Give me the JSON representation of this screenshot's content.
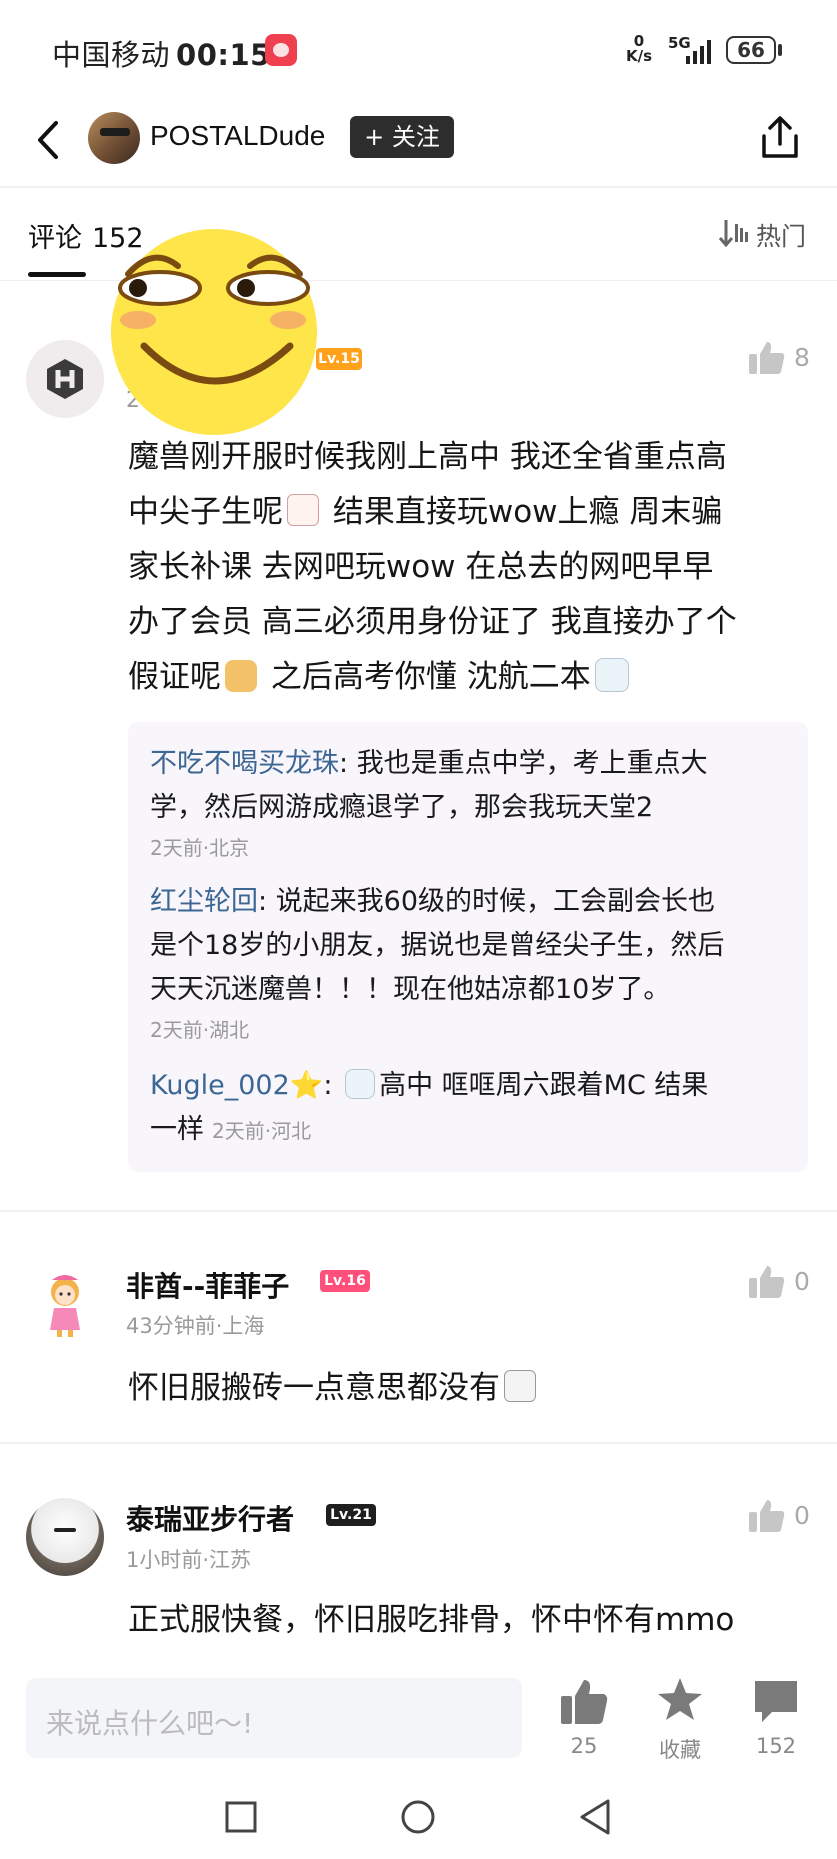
{
  "status_bar": {
    "carrier": "中国移动",
    "time": "00:15",
    "net_speed_value": "0",
    "net_speed_unit": "K/s",
    "network": "5G",
    "battery": "66"
  },
  "header": {
    "author": "POSTALDude",
    "follow_label": "+ 关注"
  },
  "comments_tab": {
    "label": "评论",
    "count": "152",
    "sort_label": "热门"
  },
  "comments": [
    {
      "level": "Lv.15",
      "time_fragment": "2",
      "likes": "8",
      "lines": [
        "魔兽刚开服时候我刚上高中 我还全省重点高",
        "中尖子生呢",
        "  结果直接玩wow上瘾 周末骗",
        "家长补课 去网吧玩wow  在总去的网吧早早",
        "办了会员 高三必须用身份证了 我直接办了个",
        "假证呢",
        " 之后高考你懂 沈航二本"
      ],
      "replies": [
        {
          "name": "不吃不喝买龙珠",
          "line1": "我也是重点中学，考上重点大",
          "line2": "学，然后网游成瘾退学了，那会我玩天堂2",
          "meta": "2天前·北京"
        },
        {
          "name": "红尘轮回",
          "line1": "说起来我60级的时候，工会副会长也",
          "line2": "是个18岁的小朋友，据说也是曾经尖子生，然后",
          "line3": "天天沉迷魔兽！！！现在他姑凉都10岁了。",
          "meta": "2天前·湖北"
        },
        {
          "name": "Kugle_002",
          "name_star": "⭐",
          "line1": "高中  哐哐周六跟着MC   结果",
          "line2": "一样",
          "meta": "2天前·河北"
        }
      ]
    },
    {
      "user": "非酋--菲菲子",
      "level": "Lv.16",
      "meta": "43分钟前·上海",
      "likes": "0",
      "text": "怀旧服搬砖一点意思都没有"
    },
    {
      "user": "泰瑞亚步行者",
      "level": "Lv.21",
      "meta": "1小时前·江苏",
      "likes": "0",
      "text": "正式服快餐，怀旧服吃排骨，怀中怀有mmo"
    }
  ],
  "bottom_bar": {
    "input_placeholder": "来说点什么吧～!",
    "likes": "25",
    "favorite_label": "收藏",
    "comment_count": "152"
  },
  "colors": {
    "accent_dark": "#2d2d2d",
    "reply_name": "#3c6694",
    "lv15": "#ffa11a",
    "lv16": "#ff4f7b",
    "lv21": "#1f1f1f"
  }
}
